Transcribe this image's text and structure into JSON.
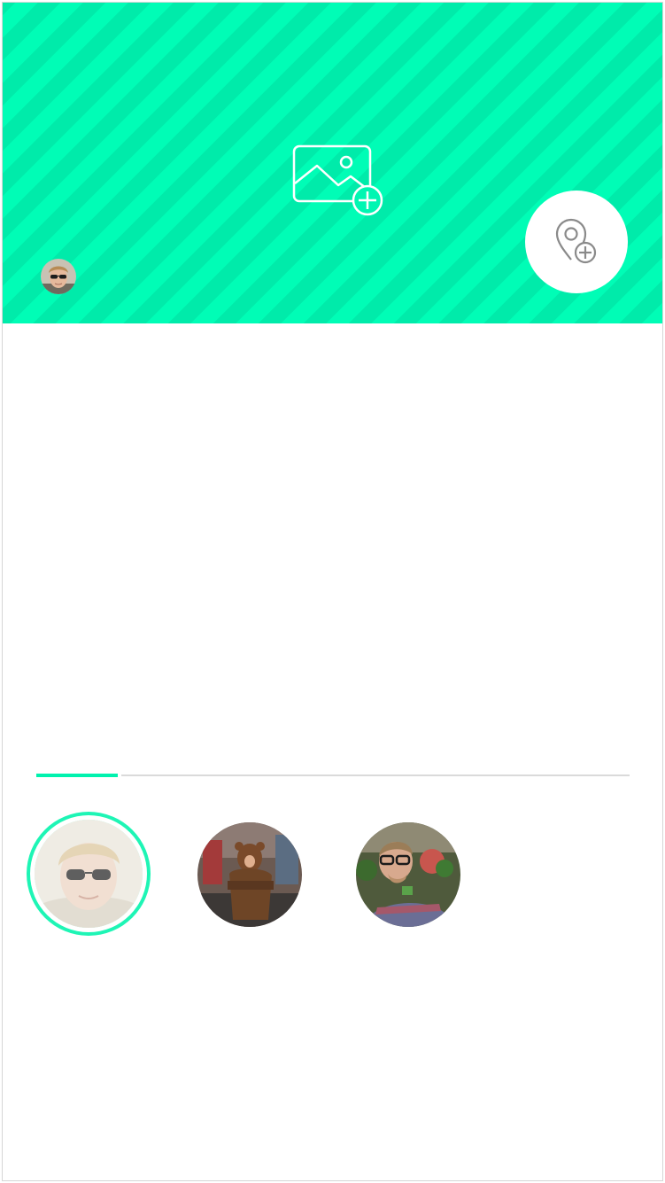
{
  "header": {
    "background_color": "#00fdb6",
    "stripe_color": "#00ebaa",
    "add_photo_icon": "image-add-icon",
    "add_location_icon": "map-pin-add-icon",
    "owner_avatar": "user-avatar"
  },
  "tabs": {
    "active_color": "#00f2ae",
    "inactive_color": "#dadada"
  },
  "people": [
    {
      "avatar": "avatar-sunglasses-man",
      "selected": true
    },
    {
      "avatar": "avatar-bear-costume",
      "selected": false
    },
    {
      "avatar": "avatar-glasses-man",
      "selected": false
    }
  ]
}
